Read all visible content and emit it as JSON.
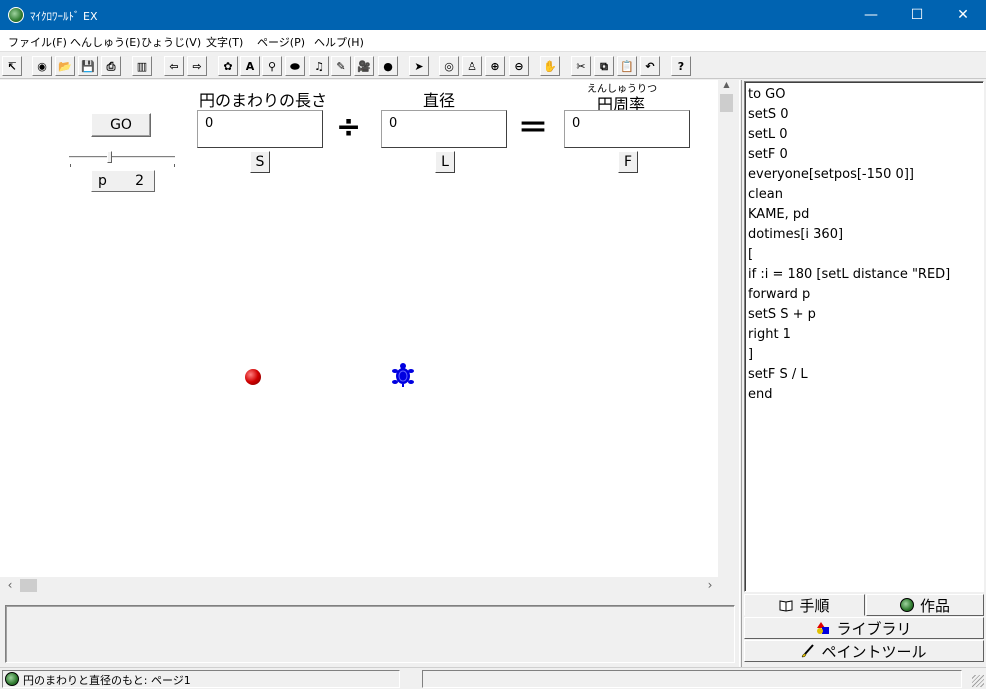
{
  "window": {
    "title": "ﾏｲｸﾛﾜｰﾙﾄﾞ EX",
    "minimize_glyph": "—",
    "maximize_glyph": "☐",
    "close_glyph": "✕"
  },
  "menu": [
    "ファイル(F)",
    "へんしゅう(E)",
    "ひょうじ(V)",
    "文字(T)",
    "ページ(P)",
    "ヘルプ(H)"
  ],
  "toolbar": {
    "buttons": [
      {
        "icon": "pointer-small-icon",
        "glyph": "↸"
      },
      {
        "icon": "globe-icon",
        "glyph": "◉"
      },
      {
        "icon": "open-folder-icon",
        "glyph": "📂"
      },
      {
        "icon": "save-icon",
        "glyph": "💾"
      },
      {
        "icon": "print-icon",
        "glyph": "⎙"
      },
      {
        "icon": "book-icon",
        "glyph": "▥"
      },
      {
        "icon": "arrow-left-icon",
        "glyph": "⇦"
      },
      {
        "icon": "arrow-right-icon",
        "glyph": "⇨"
      },
      {
        "icon": "turtle-tool-icon",
        "glyph": "✿"
      },
      {
        "icon": "text-box-icon",
        "glyph": "A"
      },
      {
        "icon": "slider-tool-icon",
        "glyph": "⚲"
      },
      {
        "icon": "button-tool-icon",
        "glyph": "⬬"
      },
      {
        "icon": "music-icon",
        "glyph": "♫"
      },
      {
        "icon": "pen-icon",
        "glyph": "✎"
      },
      {
        "icon": "movie-icon",
        "glyph": "🎥"
      },
      {
        "icon": "globe-blue-icon",
        "glyph": "●"
      },
      {
        "icon": "select-arrow-icon",
        "glyph": "➤"
      },
      {
        "icon": "eye-icon",
        "glyph": "◎"
      },
      {
        "icon": "stamp-icon",
        "glyph": "♙"
      },
      {
        "icon": "zoom-in-icon",
        "glyph": "⊕"
      },
      {
        "icon": "zoom-out-icon",
        "glyph": "⊖"
      },
      {
        "icon": "stop-hand-icon",
        "glyph": "✋"
      },
      {
        "icon": "cut-icon",
        "glyph": "✂"
      },
      {
        "icon": "copy-icon",
        "glyph": "⧉"
      },
      {
        "icon": "paste-icon",
        "glyph": "📋"
      },
      {
        "icon": "undo-icon",
        "glyph": "↶"
      },
      {
        "icon": "help-icon",
        "glyph": "?"
      }
    ]
  },
  "canvas": {
    "go_button": "GO",
    "slider": {
      "name": "p",
      "value": "2",
      "level": 0.4
    },
    "labels": {
      "circumference": "円のまわりの長さ",
      "diameter": "直径",
      "pi_ruby": "えんしゅうりつ",
      "pi": "円周率"
    },
    "boxes": [
      {
        "value": "0",
        "var": "S"
      },
      {
        "value": "0",
        "var": "L"
      },
      {
        "value": "0",
        "var": "F"
      }
    ],
    "divide_op": "÷",
    "equals_op": "＝"
  },
  "code": [
    "to GO",
    "setS 0",
    "setL 0",
    "setF 0",
    "everyone[setpos[-150 0]]",
    "clean",
    "KAME, pd",
    "dotimes[i 360]",
    "[",
    "if :i = 180 [setL distance \"RED]",
    "forward p",
    "setS S + p",
    "right 1",
    "]",
    "setF S / L",
    "end"
  ],
  "tabs": {
    "procedure": "手順",
    "works": "作品",
    "library": "ライブラリ",
    "paint_tool": "ペイントツール"
  },
  "status": {
    "text": "円のまわりと直径のもと: ページ1"
  },
  "colors": {
    "titlebar": "#0063b1",
    "ball": "#d00000",
    "turtle": "#0000e0"
  }
}
